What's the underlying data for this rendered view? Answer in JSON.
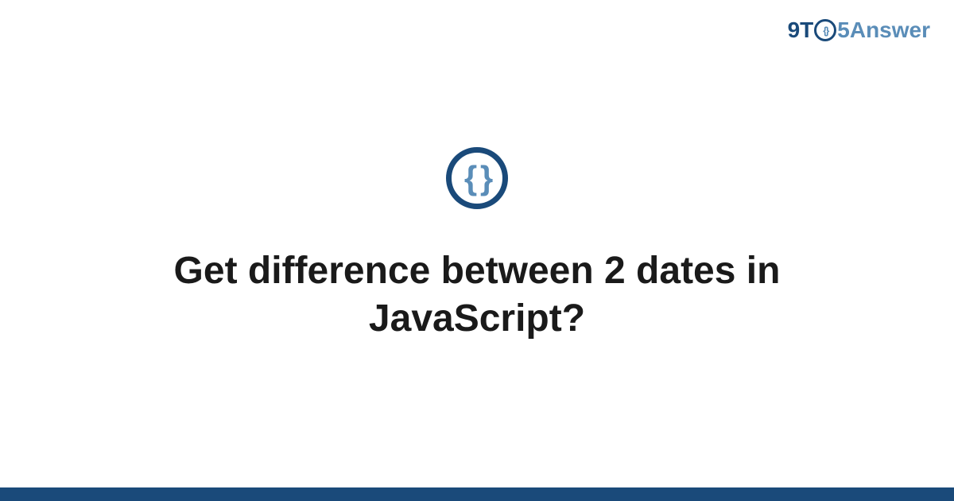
{
  "logo": {
    "prefix": "9T",
    "o_inner": "{}",
    "suffix": "5Answer"
  },
  "icon": {
    "braces": "{ }"
  },
  "title": "Get difference between 2 dates in JavaScript?",
  "colors": {
    "primary": "#1a4a7a",
    "secondary": "#5a8db8"
  }
}
